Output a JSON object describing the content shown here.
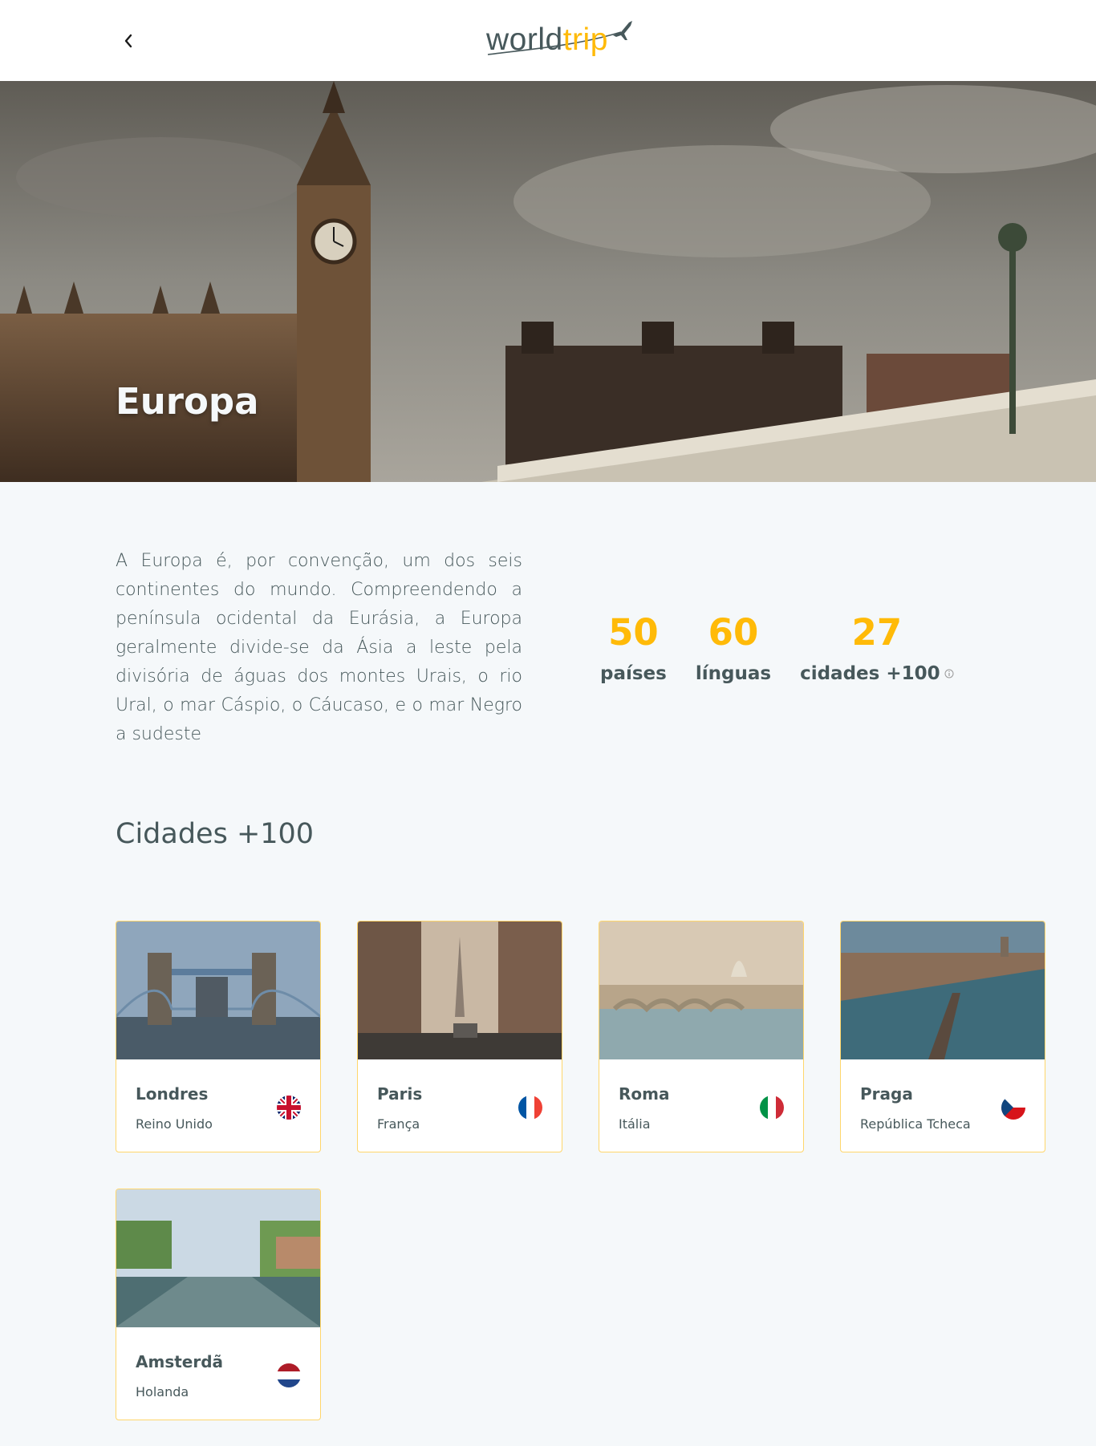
{
  "header": {
    "back_icon": "chevron-left-icon",
    "logo_world": "world",
    "logo_trip": "trip",
    "logo_icon": "airplane-icon"
  },
  "banner": {
    "title": "Europa"
  },
  "continent": {
    "description": "A Europa é, por convenção, um dos seis continentes do mundo. Compreendendo a península ocidental da Eurásia, a Europa geralmente divide-se da Ásia a leste pela divisória de águas dos montes Urais, o rio Ural, o mar Cáspio, o Cáucaso, e o mar Negro a sudeste",
    "stats": [
      {
        "value": "50",
        "label": "países"
      },
      {
        "value": "60",
        "label": "línguas"
      },
      {
        "value": "27",
        "label": "cidades +100",
        "icon": "info-icon"
      }
    ]
  },
  "cities": {
    "title": "Cidades +100",
    "items": [
      {
        "name": "Londres",
        "country": "Reino Unido",
        "flag": "uk-flag"
      },
      {
        "name": "Paris",
        "country": "França",
        "flag": "france-flag"
      },
      {
        "name": "Roma",
        "country": "Itália",
        "flag": "italy-flag"
      },
      {
        "name": "Praga",
        "country": "República Tcheca",
        "flag": "czech-flag"
      },
      {
        "name": "Amsterdã",
        "country": "Holanda",
        "flag": "netherlands-flag"
      }
    ]
  },
  "colors": {
    "highlight": "#FFBA08",
    "text": "#47585B",
    "light": "#F5F8FA",
    "white": "#FFFFFF"
  }
}
